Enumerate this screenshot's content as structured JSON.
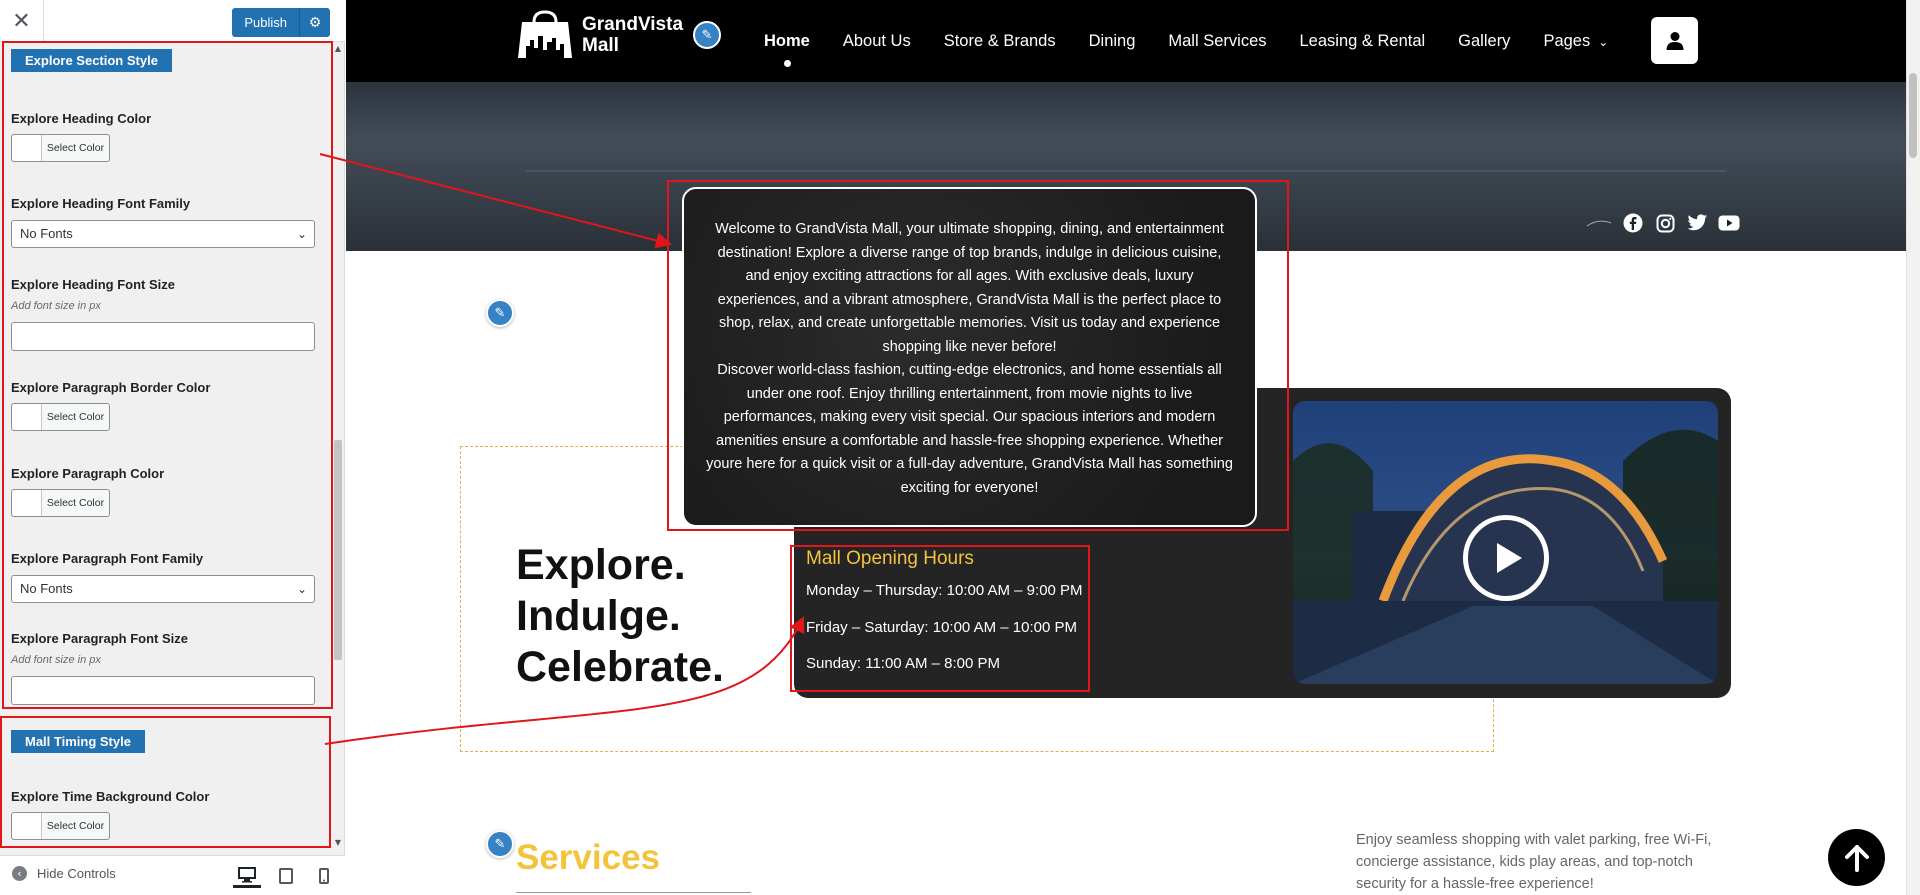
{
  "customizer": {
    "close_label": "✕",
    "publish_label": "Publish",
    "sections": {
      "explore": "Explore Section Style",
      "mall_timing": "Mall Timing Style"
    },
    "controls": {
      "heading_color": {
        "label": "Explore Heading Color",
        "button": "Select Color"
      },
      "heading_font_family": {
        "label": "Explore Heading Font Family",
        "value": "No Fonts"
      },
      "heading_font_size": {
        "label": "Explore Heading Font Size",
        "desc": "Add font size in px",
        "value": ""
      },
      "para_border_color": {
        "label": "Explore Paragraph Border Color",
        "button": "Select Color"
      },
      "para_color": {
        "label": "Explore Paragraph Color",
        "button": "Select Color"
      },
      "para_font_family": {
        "label": "Explore Paragraph Font Family",
        "value": "No Fonts"
      },
      "para_font_size": {
        "label": "Explore Paragraph Font Size",
        "desc": "Add font size in px",
        "value": ""
      },
      "time_bg_color": {
        "label": "Explore Time Background Color",
        "button": "Select Color"
      }
    },
    "footer": {
      "hide_controls": "Hide Controls"
    }
  },
  "site": {
    "logo_text": "GrandVista Mall",
    "nav": [
      "Home",
      "About Us",
      "Store & Brands",
      "Dining",
      "Mall Services",
      "Leasing & Rental",
      "Gallery",
      "Pages"
    ],
    "active_nav": "Home",
    "welcome_p1": "Welcome to GrandVista Mall, your ultimate shopping, dining, and entertainment destination! Explore a diverse range of top brands, indulge in delicious cuisine, and enjoy exciting attractions for all ages. With exclusive deals, luxury experiences, and a vibrant atmosphere, GrandVista Mall is the perfect place to shop, relax, and create unforgettable memories. Visit us today and experience shopping like never before!",
    "welcome_p2": "Discover world-class fashion, cutting-edge electronics, and home essentials all under one roof. Enjoy thrilling entertainment, from movie nights to live performances, making every visit special. Our spacious interiors and modern amenities ensure a comfortable and hassle-free shopping experience. Whether youre here for a quick visit or a full-day adventure, GrandVista Mall has something exciting for everyone!",
    "explore_lines": [
      "Explore.",
      "Indulge.",
      "Celebrate."
    ],
    "hours": {
      "title": "Mall Opening Hours",
      "lines": [
        "Monday – Thursday: 10:00 AM – 9:00 PM",
        "Friday – Saturday: 10:00 AM – 10:00 PM",
        "Sunday: 11:00 AM – 8:00 PM"
      ]
    },
    "services_title": "Services",
    "services_desc": "Enjoy seamless shopping with valet parking, free Wi-Fi, concierge assistance, kids play areas, and top-notch security for a hassle-free experience!"
  },
  "colors": {
    "wp_blue": "#2271b1",
    "annotation_red": "#e0161b",
    "accent_yellow": "#f5c33b",
    "edit_pencil": "#3582c4"
  },
  "icons": [
    "close-icon",
    "gear-icon",
    "pencil-icon",
    "user-icon",
    "facebook-icon",
    "instagram-icon",
    "twitter-icon",
    "youtube-icon",
    "play-icon",
    "arrow-up-icon",
    "desktop-icon",
    "tablet-icon",
    "mobile-icon",
    "chevron-down-icon"
  ]
}
